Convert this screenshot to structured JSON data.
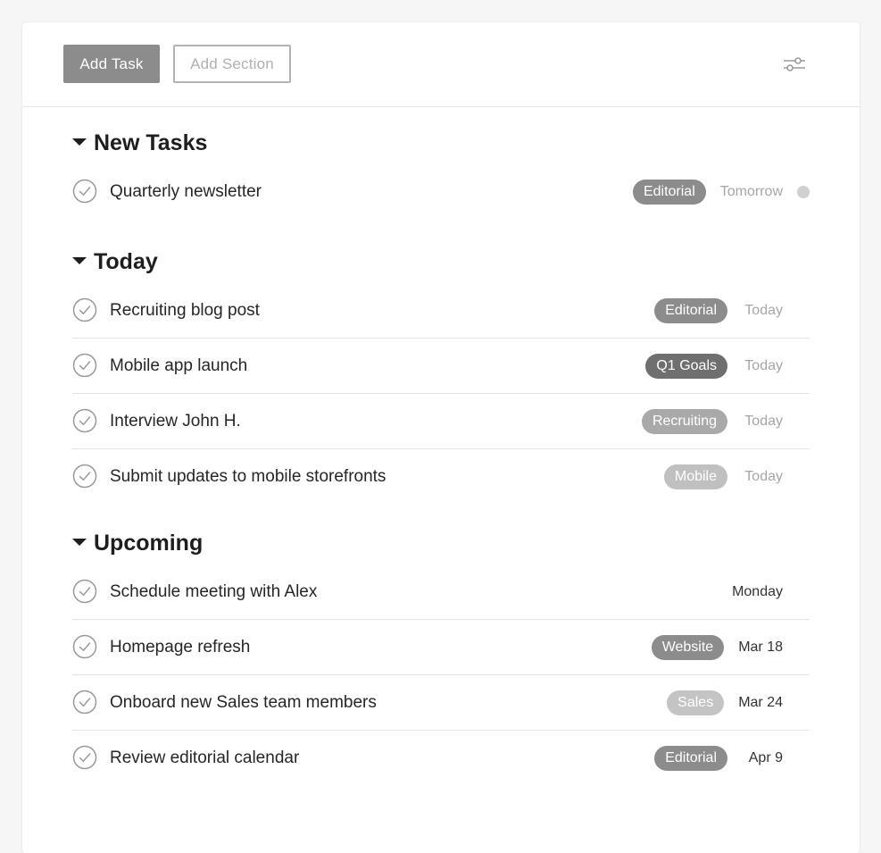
{
  "toolbar": {
    "add_task_label": "Add Task",
    "add_section_label": "Add Section",
    "filter_icon": "sliders-icon"
  },
  "colors": {
    "tag_editorial": "#8c8c8c",
    "tag_q1goals": "#6f6f6f",
    "tag_recruiting": "#a9a9a9",
    "tag_mobile": "#c0c0c0",
    "tag_website": "#8c8c8c",
    "tag_sales": "#c4c4c4",
    "due_muted": "#a6a6a6",
    "due_dark": "#333333"
  },
  "sections": [
    {
      "title": "New Tasks",
      "tasks": [
        {
          "title": "Quarterly newsletter",
          "tag": "Editorial",
          "due": "Tomorrow"
        }
      ]
    },
    {
      "title": "Today",
      "tasks": [
        {
          "title": "Recruiting blog post",
          "tag": "Editorial",
          "due": "Today"
        },
        {
          "title": "Mobile app launch",
          "tag": "Q1 Goals",
          "due": "Today"
        },
        {
          "title": "Interview John H.",
          "tag": "Recruiting",
          "due": "Today"
        },
        {
          "title": "Submit updates to mobile storefronts",
          "tag": "Mobile",
          "due": "Today"
        }
      ]
    },
    {
      "title": "Upcoming",
      "tasks": [
        {
          "title": "Schedule meeting with Alex",
          "tag": "",
          "due": "Monday"
        },
        {
          "title": "Homepage refresh",
          "tag": "Website",
          "due": "Mar 18"
        },
        {
          "title": "Onboard new Sales team members",
          "tag": "Sales",
          "due": "Mar 24"
        },
        {
          "title": "Review editorial calendar",
          "tag": "Editorial",
          "due": "Apr 9"
        }
      ]
    }
  ]
}
